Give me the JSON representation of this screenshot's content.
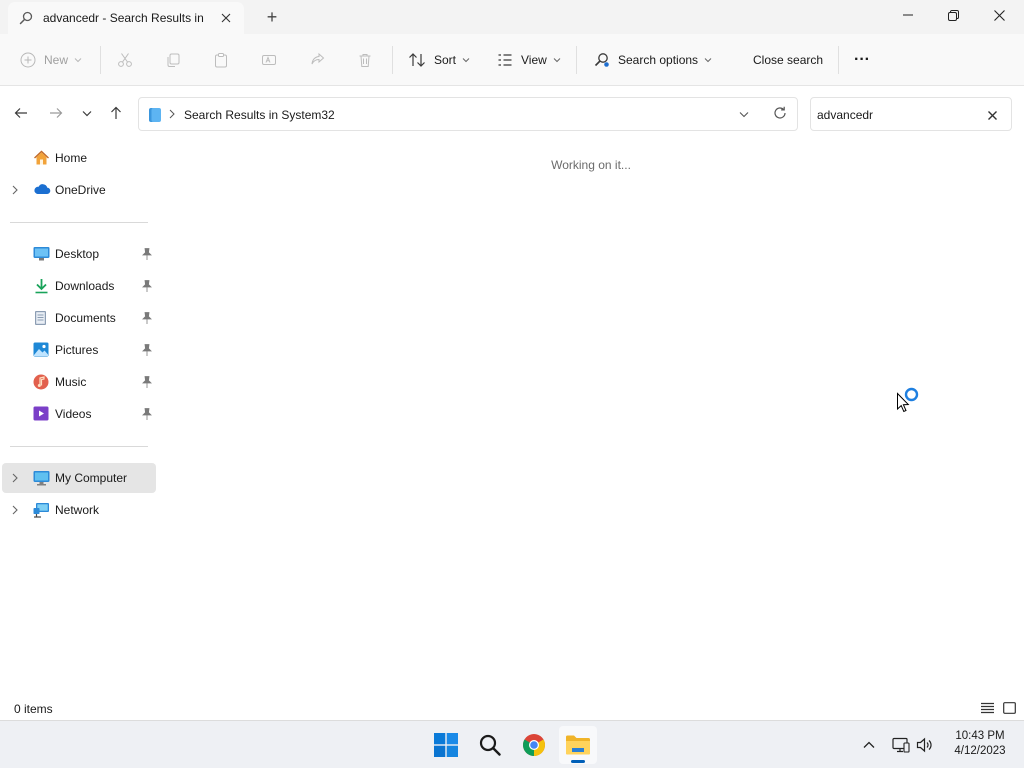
{
  "window": {
    "tab_title": "advancedr - Search Results in",
    "tab_icon": "search-icon",
    "new_tab": "+",
    "controls": [
      "minimize",
      "restore",
      "close"
    ]
  },
  "toolbar": {
    "new_label": "New",
    "sort_label": "Sort",
    "view_label": "View",
    "search_options_label": "Search options",
    "close_search_label": "Close search",
    "more_label": "···",
    "disabled_actions": [
      "cut",
      "copy",
      "paste",
      "rename",
      "share",
      "delete"
    ]
  },
  "address": {
    "location": "Search Results in System32",
    "search_value": "advancedr"
  },
  "sidebar": {
    "top": [
      {
        "label": "Home",
        "icon": "home-icon",
        "expandable": false
      },
      {
        "label": "OneDrive",
        "icon": "cloud-icon",
        "expandable": true
      }
    ],
    "quick_access": [
      {
        "label": "Desktop",
        "icon": "desktop-icon"
      },
      {
        "label": "Downloads",
        "icon": "download-icon"
      },
      {
        "label": "Documents",
        "icon": "document-icon"
      },
      {
        "label": "Pictures",
        "icon": "pictures-icon"
      },
      {
        "label": "Music",
        "icon": "music-icon"
      },
      {
        "label": "Videos",
        "icon": "videos-icon"
      }
    ],
    "locations": [
      {
        "label": "My Computer",
        "icon": "computer-icon",
        "selected": true
      },
      {
        "label": "Network",
        "icon": "network-icon",
        "selected": false
      }
    ]
  },
  "main": {
    "status_message": "Working on it..."
  },
  "statusbar": {
    "item_count": "0 items"
  },
  "taskbar": {
    "apps": [
      "start-icon",
      "search-icon",
      "chrome-icon",
      "file-explorer-icon"
    ],
    "time": "10:43 PM",
    "date": "4/12/2023"
  },
  "colors": {
    "accent": "#005fb8",
    "selection": "#e5e5e5",
    "disabled_text": "#a0a0a0"
  }
}
